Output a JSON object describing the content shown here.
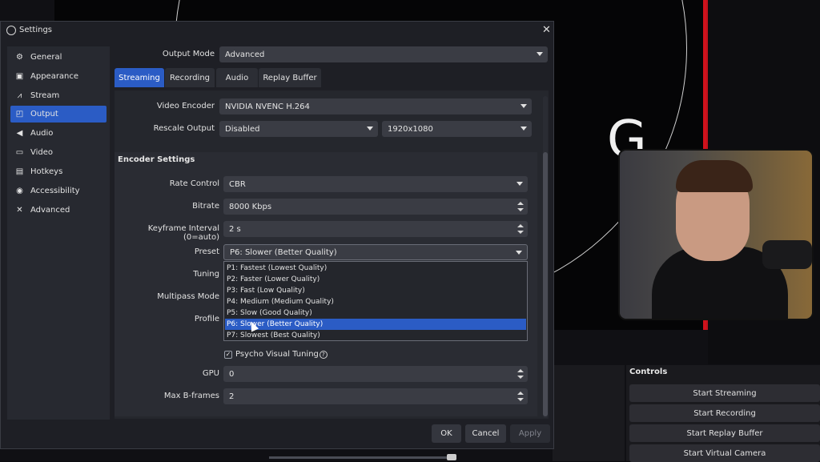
{
  "window": {
    "title": "Settings"
  },
  "sidebar": {
    "items": [
      {
        "label": "General",
        "icon": "gear-icon"
      },
      {
        "label": "Appearance",
        "icon": "palette-icon"
      },
      {
        "label": "Stream",
        "icon": "broadcast-icon"
      },
      {
        "label": "Output",
        "icon": "output-icon"
      },
      {
        "label": "Audio",
        "icon": "speaker-icon"
      },
      {
        "label": "Video",
        "icon": "monitor-icon"
      },
      {
        "label": "Hotkeys",
        "icon": "keyboard-icon"
      },
      {
        "label": "Accessibility",
        "icon": "accessibility-icon"
      },
      {
        "label": "Advanced",
        "icon": "tools-icon"
      }
    ],
    "active_index": 3
  },
  "output_mode": {
    "label": "Output Mode",
    "value": "Advanced"
  },
  "tabs": [
    "Streaming",
    "Recording",
    "Audio",
    "Replay Buffer"
  ],
  "streaming": {
    "video_encoder": {
      "label": "Video Encoder",
      "value": "NVIDIA NVENC H.264"
    },
    "rescale_output": {
      "label": "Rescale Output",
      "value": "Disabled",
      "resolution": "1920x1080"
    }
  },
  "encoder_settings": {
    "heading": "Encoder Settings",
    "rate_control": {
      "label": "Rate Control",
      "value": "CBR"
    },
    "bitrate": {
      "label": "Bitrate",
      "value": "8000 Kbps"
    },
    "keyframe_interval": {
      "label": "Keyframe Interval (0=auto)",
      "value": "2 s"
    },
    "preset": {
      "label": "Preset",
      "value": "P6: Slower (Better Quality)"
    },
    "tuning": {
      "label": "Tuning"
    },
    "multipass": {
      "label": "Multipass Mode"
    },
    "profile": {
      "label": "Profile"
    },
    "psycho_visual": {
      "label": "Psycho Visual Tuning",
      "checked": true
    },
    "gpu": {
      "label": "GPU",
      "value": "0"
    },
    "max_bframes": {
      "label": "Max B-frames",
      "value": "2"
    }
  },
  "preset_dropdown": {
    "options": [
      "P1: Fastest (Lowest Quality)",
      "P2: Faster (Lower Quality)",
      "P3: Fast (Low Quality)",
      "P4: Medium (Medium Quality)",
      "P5: Slow (Good Quality)",
      "P6: Slower (Better Quality)",
      "P7: Slowest (Best Quality)"
    ],
    "selected_index": 5
  },
  "footer": {
    "ok": "OK",
    "cancel": "Cancel",
    "apply": "Apply"
  },
  "controls": {
    "title": "Controls",
    "buttons": [
      "Start Streaming",
      "Start Recording",
      "Start Replay Buffer",
      "Start Virtual Camera"
    ]
  },
  "colors": {
    "accent": "#2b5cc5",
    "scene_red": "#d0121c"
  }
}
